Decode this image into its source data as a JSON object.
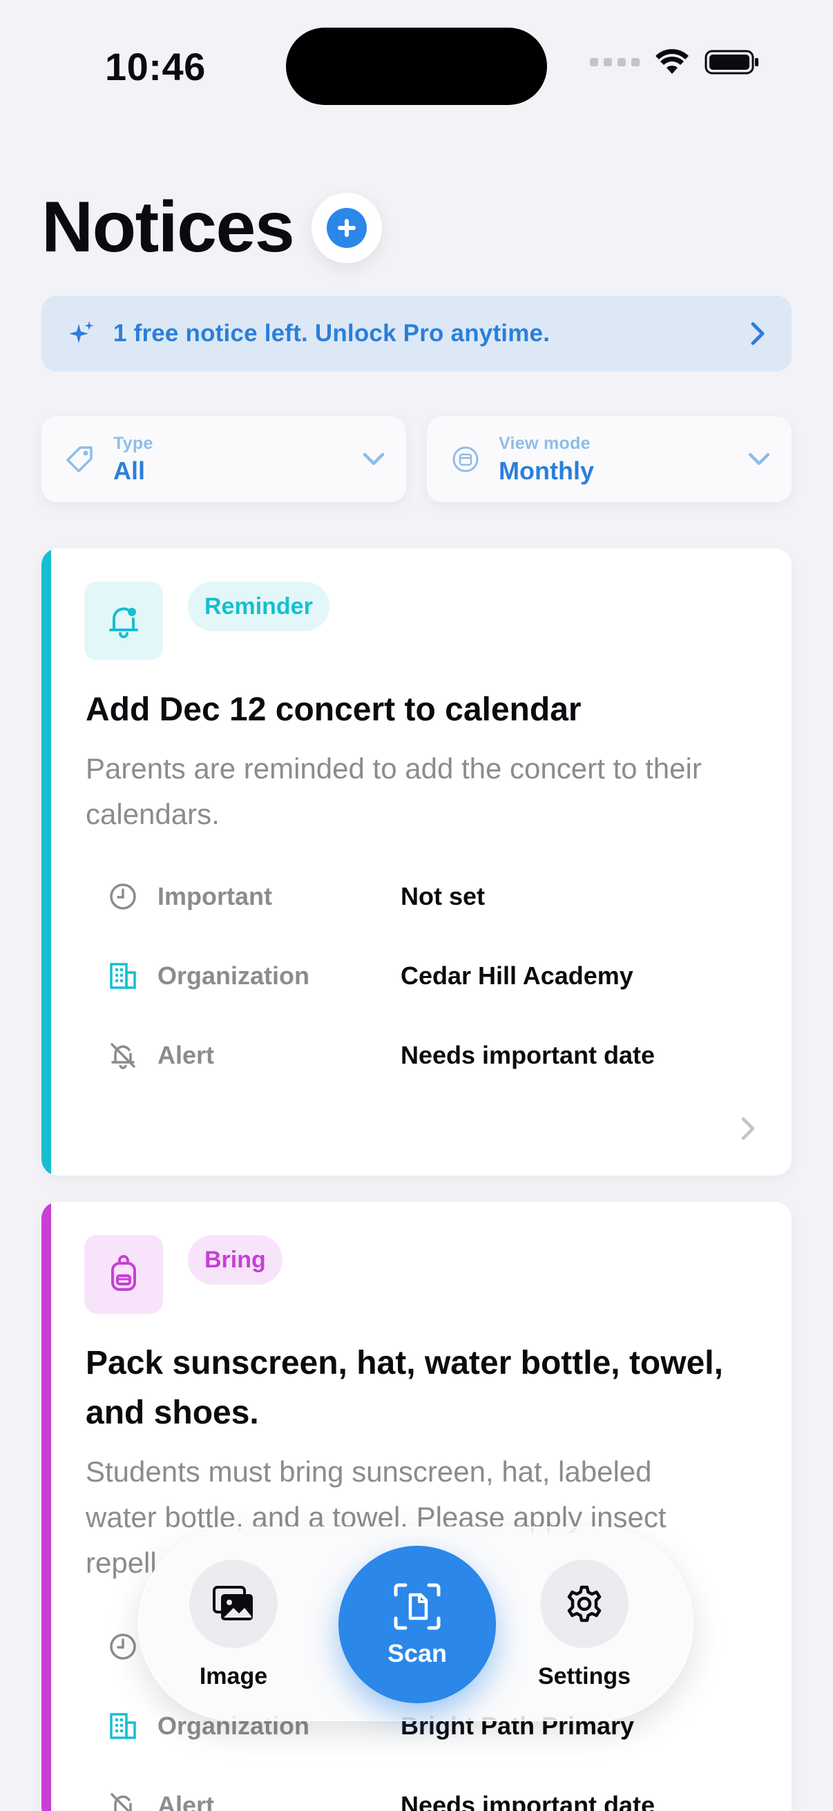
{
  "status_bar": {
    "time": "10:46"
  },
  "header": {
    "title": "Notices"
  },
  "banner": {
    "text": "1 free notice left. Unlock Pro anytime."
  },
  "filters": {
    "type": {
      "label": "Type",
      "value": "All"
    },
    "view_mode": {
      "label": "View mode",
      "value": "Monthly"
    }
  },
  "cards": [
    {
      "badge": "Reminder",
      "accent_color": "#16bfcf",
      "title": "Add Dec 12 concert to calendar",
      "description": "Parents are reminded to add the concert to their calendars.",
      "rows": [
        {
          "label": "Important",
          "value": "Not set"
        },
        {
          "label": "Organization",
          "value": "Cedar Hill Academy"
        },
        {
          "label": "Alert",
          "value": "Needs important date"
        }
      ]
    },
    {
      "badge": "Bring",
      "accent_color": "#c83fd6",
      "title": "Pack sunscreen, hat, water bottle, towel, and shoes.",
      "description": "Students must bring sunscreen, hat, labeled water bottle, and a towel. Please apply insect repell",
      "rows": [
        {
          "label": "",
          "value": ""
        },
        {
          "label": "Organization",
          "value": "Bright Path Primary"
        },
        {
          "label": "Alert",
          "value": "Needs important date"
        }
      ]
    }
  ],
  "tabbar": {
    "image_label": "Image",
    "scan_label": "Scan",
    "settings_label": "Settings"
  },
  "colors": {
    "accent_blue": "#2b87e8",
    "reminder_teal": "#16bfcf",
    "bring_magenta": "#c83fd6"
  }
}
